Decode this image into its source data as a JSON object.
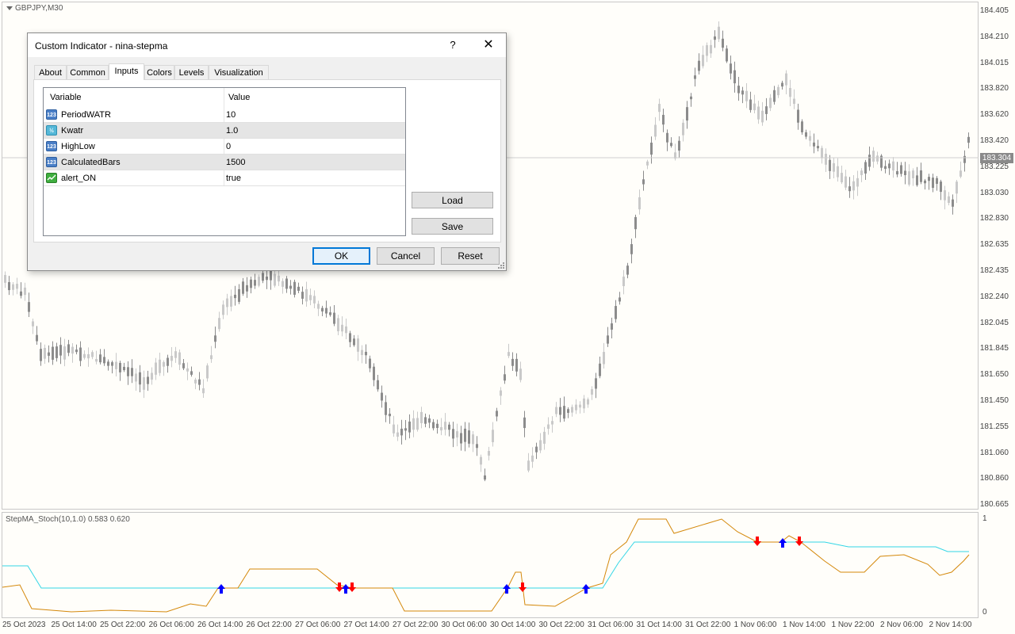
{
  "chart": {
    "symbol": "GBPJPY,M30",
    "current_price": "183.304",
    "price_scale": [
      "184.405",
      "184.210",
      "184.015",
      "183.820",
      "183.620",
      "183.420",
      "183.225",
      "183.030",
      "182.830",
      "182.635",
      "182.435",
      "182.240",
      "182.045",
      "181.845",
      "181.650",
      "181.450",
      "181.255",
      "181.060",
      "180.860",
      "180.665"
    ],
    "time_labels": [
      "25 Oct 2023",
      "25 Oct 14:00",
      "25 Oct 22:00",
      "26 Oct 06:00",
      "26 Oct 14:00",
      "26 Oct 22:00",
      "27 Oct 06:00",
      "27 Oct 14:00",
      "27 Oct 22:00",
      "30 Oct 06:00",
      "30 Oct 14:00",
      "30 Oct 22:00",
      "31 Oct 06:00",
      "31 Oct 14:00",
      "31 Oct 22:00",
      "1 Nov 06:00",
      "1 Nov 14:00",
      "1 Nov 22:00",
      "2 Nov 06:00",
      "2 Nov 14:00"
    ],
    "indicator_label": "StepMA_Stoch(10,1.0) 0.583 0.620",
    "indicator_scale_top": "1",
    "indicator_scale_bottom": "0",
    "colors": {
      "candle": "#8c8c8c",
      "orange_line": "#d4880a",
      "cyan_line": "#33d6e6",
      "up_arrow": "#0000ff",
      "down_arrow": "#ff0000"
    }
  },
  "dialog": {
    "title": "Custom Indicator - nina-stepma",
    "help_label": "?",
    "close_label": "✕",
    "tabs": [
      {
        "label": "About",
        "active": false
      },
      {
        "label": "Common",
        "active": false
      },
      {
        "label": "Inputs",
        "active": true
      },
      {
        "label": "Colors",
        "active": false
      },
      {
        "label": "Levels",
        "active": false
      },
      {
        "label": "Visualization",
        "active": false
      }
    ],
    "grid": {
      "col_variable": "Variable",
      "col_value": "Value",
      "rows": [
        {
          "icon": "int-icon",
          "icon_text": "123",
          "variable": "PeriodWATR",
          "value": "10"
        },
        {
          "icon": "double-icon",
          "icon_text": "½",
          "variable": "Kwatr",
          "value": "1.0"
        },
        {
          "icon": "int-icon",
          "icon_text": "123",
          "variable": "HighLow",
          "value": "0"
        },
        {
          "icon": "int-icon",
          "icon_text": "123",
          "variable": "CalculatedBars",
          "value": "1500"
        },
        {
          "icon": "bool-icon",
          "icon_text": "",
          "variable": "alert_ON",
          "value": "true"
        }
      ]
    },
    "buttons": {
      "load": "Load",
      "save": "Save",
      "ok": "OK",
      "cancel": "Cancel",
      "reset": "Reset"
    }
  }
}
